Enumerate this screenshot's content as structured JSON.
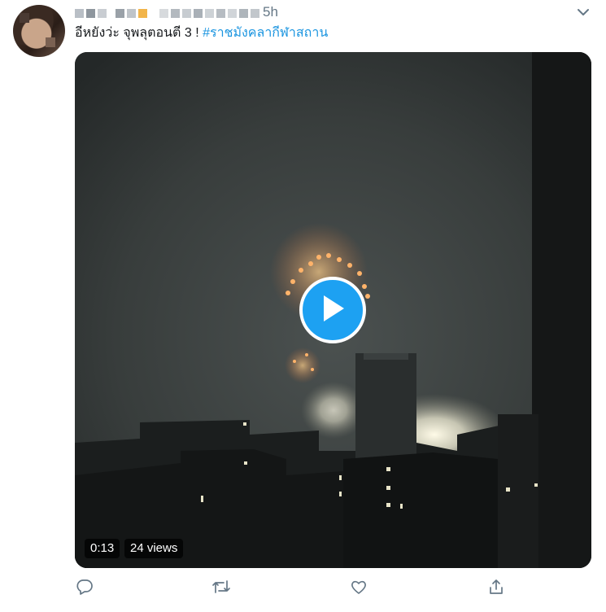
{
  "tweet": {
    "timestamp": "5h",
    "text_plain": "อีหยังว่ะ จุพลุตอนตี 3 !",
    "hashtag": "#ราชมังคลากีฬาสถาน",
    "menu_icon": "chevron-down-icon"
  },
  "video": {
    "duration": "0:13",
    "views": "24 views",
    "play_icon": "play-icon"
  },
  "actions": [
    {
      "name": "reply",
      "icon": "reply-icon"
    },
    {
      "name": "retweet",
      "icon": "retweet-icon"
    },
    {
      "name": "like",
      "icon": "heart-icon"
    },
    {
      "name": "share",
      "icon": "share-icon"
    }
  ],
  "colors": {
    "accent": "#1b95e0",
    "play_button": "#1da1f2",
    "icon_gray": "#657786"
  }
}
